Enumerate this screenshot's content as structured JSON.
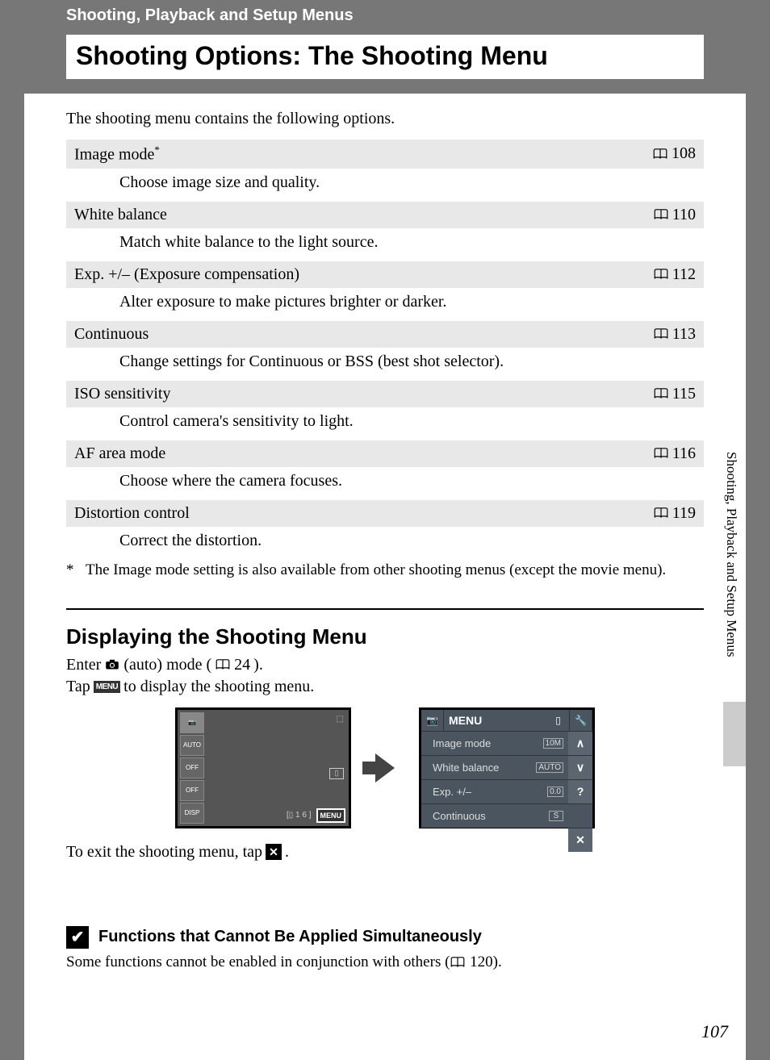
{
  "header": {
    "section": "Shooting, Playback and Setup Menus",
    "title": "Shooting Options: The Shooting Menu"
  },
  "intro": "The shooting menu contains the following options.",
  "options": [
    {
      "label": "Image mode",
      "star": "*",
      "page": "108",
      "desc": "Choose image size and quality."
    },
    {
      "label": "White balance",
      "star": "",
      "page": "110",
      "desc": "Match white balance to the light source."
    },
    {
      "label": "Exp. +/– (Exposure compensation)",
      "star": "",
      "page": "112",
      "desc": "Alter exposure to make pictures brighter or darker."
    },
    {
      "label": "Continuous",
      "star": "",
      "page": "113",
      "desc": "Change settings for Continuous or BSS (best shot selector)."
    },
    {
      "label": "ISO sensitivity",
      "star": "",
      "page": "115",
      "desc": "Control camera's sensitivity to light."
    },
    {
      "label": "AF area mode",
      "star": "",
      "page": "116",
      "desc": "Choose where the camera focuses."
    },
    {
      "label": "Distortion control",
      "star": "",
      "page": "119",
      "desc": "Correct the distortion."
    }
  ],
  "footnote": {
    "mark": "*",
    "text": "The Image mode setting is also available from other shooting menus (except the movie menu)."
  },
  "section2": {
    "heading": "Displaying the Shooting Menu",
    "line1a": "Enter ",
    "line1b": " (auto) mode (",
    "line1_page": "24",
    "line1c": ").",
    "line2a": "Tap ",
    "menu_label": "MENU",
    "line2b": " to display the shooting menu.",
    "exit_a": "To exit the shooting menu, tap ",
    "exit_b": "."
  },
  "screen1": {
    "side": [
      "📷",
      "AUTO",
      "OFF",
      "OFF",
      "DISP"
    ],
    "bottom_mem": "[▯  1 6 ]",
    "menu": "MENU"
  },
  "screen2": {
    "title": "MENU",
    "rows": [
      {
        "label": "Image mode",
        "val": "10M"
      },
      {
        "label": "White balance",
        "val": "AUTO"
      },
      {
        "label": "Exp. +/–",
        "val": "0.0"
      },
      {
        "label": "Continuous",
        "val": "S"
      }
    ],
    "side_buttons": [
      "∧",
      "∨",
      "?",
      "",
      "✕"
    ]
  },
  "note": {
    "title": "Functions that Cannot Be Applied Simultaneously",
    "body_a": "Some functions cannot be enabled in conjunction with others (",
    "body_page": "120",
    "body_b": ")."
  },
  "side_label": "Shooting, Playback and Setup Menus",
  "page_number": "107"
}
